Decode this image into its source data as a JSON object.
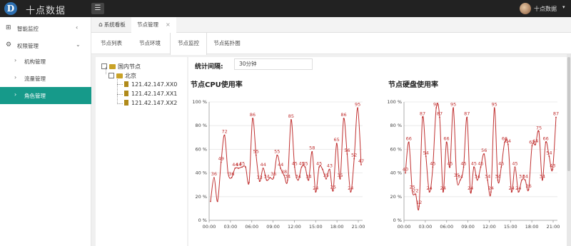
{
  "app": {
    "title": "十点数据",
    "logo_letter": "D"
  },
  "header": {
    "menu_toggle_icon": "list-icon",
    "user_name": "十点数据",
    "user_caret": "▾"
  },
  "sidebar": {
    "items": [
      {
        "label": "智能监控",
        "icon": "grid-icon",
        "chevron": "‹"
      },
      {
        "label": "权限管理",
        "icon": "gear-icon",
        "chevron": "⌄"
      }
    ],
    "sub_items": [
      {
        "label": "机构管理",
        "chevron": "›"
      },
      {
        "label": "流量管理",
        "chevron": "›"
      },
      {
        "label": "角色管理",
        "chevron": "›"
      }
    ]
  },
  "tabs": [
    {
      "label": "系统看板",
      "icon": "home-icon"
    },
    {
      "label": "节点管理",
      "close": "×"
    }
  ],
  "subtabs": [
    "节点列表",
    "节点环境",
    "节点监控",
    "节点拓扑图"
  ],
  "tree": {
    "root": "国内节点",
    "group": "北京",
    "leaves": [
      "121.42.147.XX0",
      "121.42.147.XX1",
      "121.42.147.XX2"
    ]
  },
  "interval": {
    "label": "统计间隔:",
    "value": "30分钟"
  },
  "chart_data": [
    {
      "type": "line",
      "title": "节点CPU使用率",
      "x_ticks": [
        "00:00",
        "03:00",
        "06:00",
        "09:00",
        "12:00",
        "15:00",
        "18:00",
        "21:00"
      ],
      "y_ticks": [
        "0 %",
        "20 %",
        "40 %",
        "60 %",
        "80 %",
        "100 %"
      ],
      "ylim": [
        0,
        100
      ],
      "color": "#c03030",
      "values": [
        16,
        36,
        16,
        49,
        72,
        40,
        36,
        44,
        44,
        45,
        45,
        32,
        86,
        55,
        33,
        44,
        34,
        36,
        36,
        55,
        44,
        38,
        34,
        85,
        45,
        34,
        45,
        45,
        34,
        58,
        24,
        45,
        43,
        35,
        43,
        25,
        65,
        35,
        86,
        56,
        24,
        52,
        95,
        47
      ],
      "labels": [
        {
          "i": 1,
          "v": "36"
        },
        {
          "i": 3,
          "v": "49"
        },
        {
          "i": 4,
          "v": "72"
        },
        {
          "i": 6,
          "v": "36"
        },
        {
          "i": 7,
          "v": "44"
        },
        {
          "i": 8,
          "v": "44"
        },
        {
          "i": 9,
          "v": "45"
        },
        {
          "i": 12,
          "v": "86"
        },
        {
          "i": 13,
          "v": "55"
        },
        {
          "i": 14,
          "v": "33"
        },
        {
          "i": 15,
          "v": "44"
        },
        {
          "i": 16,
          "v": "34"
        },
        {
          "i": 18,
          "v": "36"
        },
        {
          "i": 19,
          "v": "55"
        },
        {
          "i": 20,
          "v": "44"
        },
        {
          "i": 21,
          "v": "38"
        },
        {
          "i": 22,
          "v": "34"
        },
        {
          "i": 23,
          "v": "85"
        },
        {
          "i": 24,
          "v": "45"
        },
        {
          "i": 25,
          "v": "34"
        },
        {
          "i": 26,
          "v": "45"
        },
        {
          "i": 27,
          "v": "45"
        },
        {
          "i": 28,
          "v": "34"
        },
        {
          "i": 29,
          "v": "58"
        },
        {
          "i": 30,
          "v": "24"
        },
        {
          "i": 31,
          "v": "45"
        },
        {
          "i": 33,
          "v": "35"
        },
        {
          "i": 34,
          "v": "43"
        },
        {
          "i": 35,
          "v": "25"
        },
        {
          "i": 36,
          "v": "65"
        },
        {
          "i": 37,
          "v": "35"
        },
        {
          "i": 38,
          "v": "86"
        },
        {
          "i": 39,
          "v": "56"
        },
        {
          "i": 40,
          "v": "24"
        },
        {
          "i": 41,
          "v": "52"
        },
        {
          "i": 42,
          "v": "95"
        },
        {
          "i": 43,
          "v": "47"
        }
      ]
    },
    {
      "type": "line",
      "title": "节点硬盘使用率",
      "x_ticks": [
        "00:00",
        "03:00",
        "06:00",
        "09:00",
        "12:00",
        "15:00",
        "18:00",
        "21:00"
      ],
      "y_ticks": [
        "0 %",
        "20 %",
        "40 %",
        "60 %",
        "80 %",
        "100 %"
      ],
      "ylim": [
        0,
        100
      ],
      "color": "#c03030",
      "values": [
        40,
        66,
        25,
        22,
        12,
        87,
        54,
        24,
        45,
        95,
        87,
        24,
        66,
        45,
        95,
        35,
        34,
        45,
        87,
        24,
        45,
        34,
        45,
        56,
        34,
        24,
        95,
        34,
        45,
        66,
        64,
        24,
        45,
        24,
        34,
        34,
        26,
        63,
        64,
        75,
        34,
        66,
        54,
        43,
        87
      ],
      "labels": [
        {
          "i": 0,
          "v": "40"
        },
        {
          "i": 1,
          "v": "66"
        },
        {
          "i": 2,
          "v": "25"
        },
        {
          "i": 3,
          "v": "22"
        },
        {
          "i": 4,
          "v": "12"
        },
        {
          "i": 5,
          "v": "87"
        },
        {
          "i": 6,
          "v": "54"
        },
        {
          "i": 7,
          "v": "24"
        },
        {
          "i": 8,
          "v": "45"
        },
        {
          "i": 9,
          "v": "95"
        },
        {
          "i": 10,
          "v": "87"
        },
        {
          "i": 11,
          "v": "24"
        },
        {
          "i": 12,
          "v": "66"
        },
        {
          "i": 13,
          "v": "45"
        },
        {
          "i": 14,
          "v": "95"
        },
        {
          "i": 15,
          "v": "35"
        },
        {
          "i": 16,
          "v": "34"
        },
        {
          "i": 17,
          "v": "45"
        },
        {
          "i": 18,
          "v": "87"
        },
        {
          "i": 19,
          "v": "24"
        },
        {
          "i": 20,
          "v": "45"
        },
        {
          "i": 21,
          "v": "34"
        },
        {
          "i": 22,
          "v": "45"
        },
        {
          "i": 23,
          "v": "56"
        },
        {
          "i": 24,
          "v": "34"
        },
        {
          "i": 25,
          "v": "24"
        },
        {
          "i": 26,
          "v": "95"
        },
        {
          "i": 27,
          "v": "34"
        },
        {
          "i": 28,
          "v": "45"
        },
        {
          "i": 29,
          "v": "66"
        },
        {
          "i": 30,
          "v": "64"
        },
        {
          "i": 31,
          "v": "24"
        },
        {
          "i": 32,
          "v": "45"
        },
        {
          "i": 33,
          "v": "24"
        },
        {
          "i": 34,
          "v": "34"
        },
        {
          "i": 35,
          "v": "34"
        },
        {
          "i": 36,
          "v": "26"
        },
        {
          "i": 37,
          "v": "63"
        },
        {
          "i": 38,
          "v": "64"
        },
        {
          "i": 39,
          "v": "75"
        },
        {
          "i": 40,
          "v": "34"
        },
        {
          "i": 41,
          "v": "66"
        },
        {
          "i": 42,
          "v": "54"
        },
        {
          "i": 43,
          "v": "43"
        },
        {
          "i": 44,
          "v": "87"
        }
      ]
    }
  ],
  "colors": {
    "accent": "#169a8a",
    "topbar": "#222222",
    "series": "#c03030"
  }
}
